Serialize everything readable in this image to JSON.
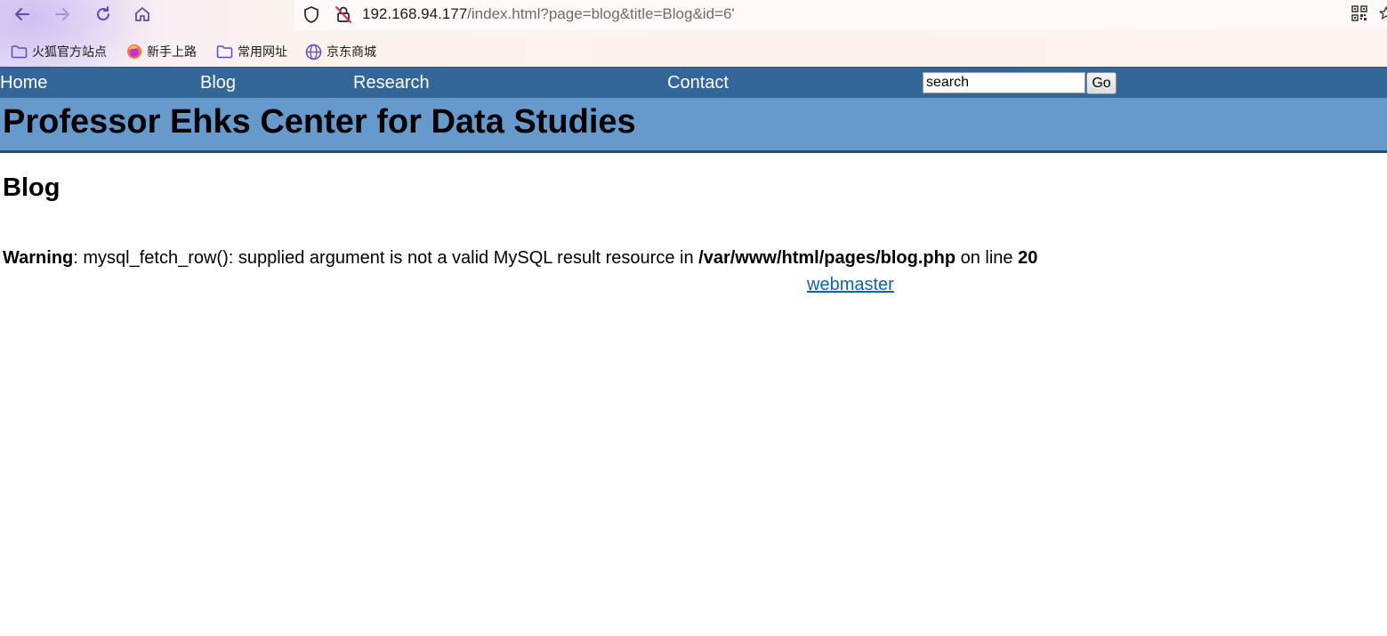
{
  "browser": {
    "url_host": "192.168.94.177",
    "url_rest": "/index.html?page=blog&title=Blog&id=6'",
    "bookmarks": [
      {
        "label": "火狐官方站点",
        "icon": "folder-icon"
      },
      {
        "label": "新手上路",
        "icon": "firefox-icon"
      },
      {
        "label": "常用网址",
        "icon": "folder-icon"
      },
      {
        "label": "京东商城",
        "icon": "globe-icon"
      }
    ],
    "icons": [
      "back-arrow-icon",
      "forward-arrow-icon",
      "reload-icon",
      "home-icon",
      "shield-icon",
      "insecure-lock-icon",
      "qr-code-icon",
      "star-icon"
    ]
  },
  "site": {
    "nav": {
      "home": "Home",
      "blog": "Blog",
      "research": "Research",
      "contact": "Contact"
    },
    "search": {
      "value": "search",
      "button": "Go"
    },
    "banner_title": "Professor Ehks Center for Data Studies"
  },
  "main": {
    "heading": "Blog",
    "warning": {
      "label": "Warning",
      "text1": ": mysql_fetch_row(): supplied argument is not a valid MySQL result resource in ",
      "path": "/var/www/html/pages/blog.php",
      "text2": " on line ",
      "line": "20"
    },
    "webmaster_link": "webmaster"
  },
  "colors": {
    "nav_bar": "#336699",
    "banner": "#6699cc",
    "link": "#0a63b8"
  }
}
